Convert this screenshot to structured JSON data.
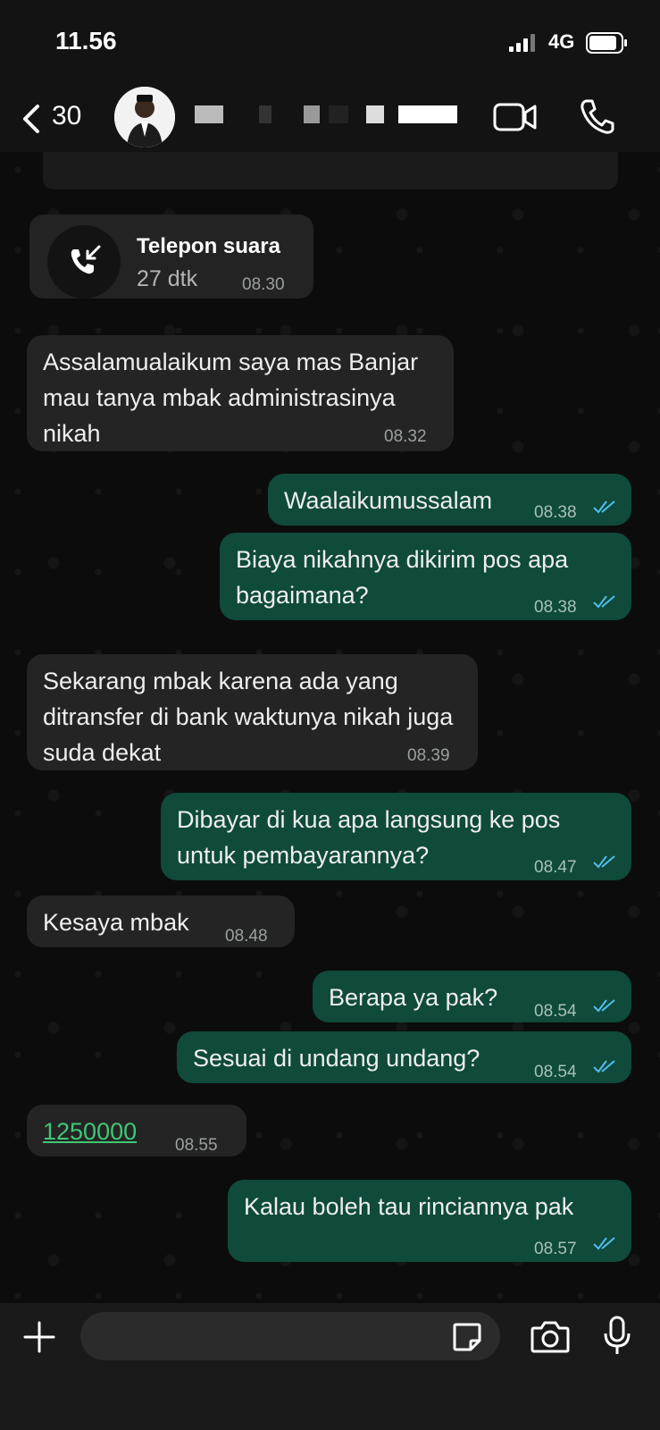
{
  "status_bar": {
    "time": "11.56",
    "network": "4G"
  },
  "header": {
    "back_count": "30"
  },
  "call": {
    "title": "Telepon suara",
    "duration": "27 dtk",
    "time": "08.30"
  },
  "messages": [
    {
      "text": "Assalamualaikum saya mas     Banjar mau tanya mbak administrasinya nikah",
      "time": "08.32"
    },
    {
      "text": "Waalaikumussalam",
      "time": "08.38"
    },
    {
      "text": "Biaya nikahnya dikirim pos apa bagaimana?",
      "time": "08.38"
    },
    {
      "text": "Sekarang mbak karena ada yang ditransfer di bank waktunya nikah juga suda dekat",
      "time": "08.39"
    },
    {
      "text": "Dibayar di kua apa langsung ke pos untuk pembayarannya?",
      "time": "08.47"
    },
    {
      "text": "Kesaya mbak",
      "time": "08.48"
    },
    {
      "text": "Berapa ya pak?",
      "time": "08.54"
    },
    {
      "text": "Sesuai di undang undang?",
      "time": "08.54"
    },
    {
      "text": "1250000",
      "time": "08.55"
    },
    {
      "text": "Kalau boleh tau rinciannya pak",
      "time": "08.57"
    }
  ],
  "compose": {
    "placeholder": ""
  },
  "colors": {
    "outgoing": "#0f4a3a",
    "incoming": "#242424",
    "link": "#3ec774",
    "read_ticks": "#53bdeb"
  }
}
